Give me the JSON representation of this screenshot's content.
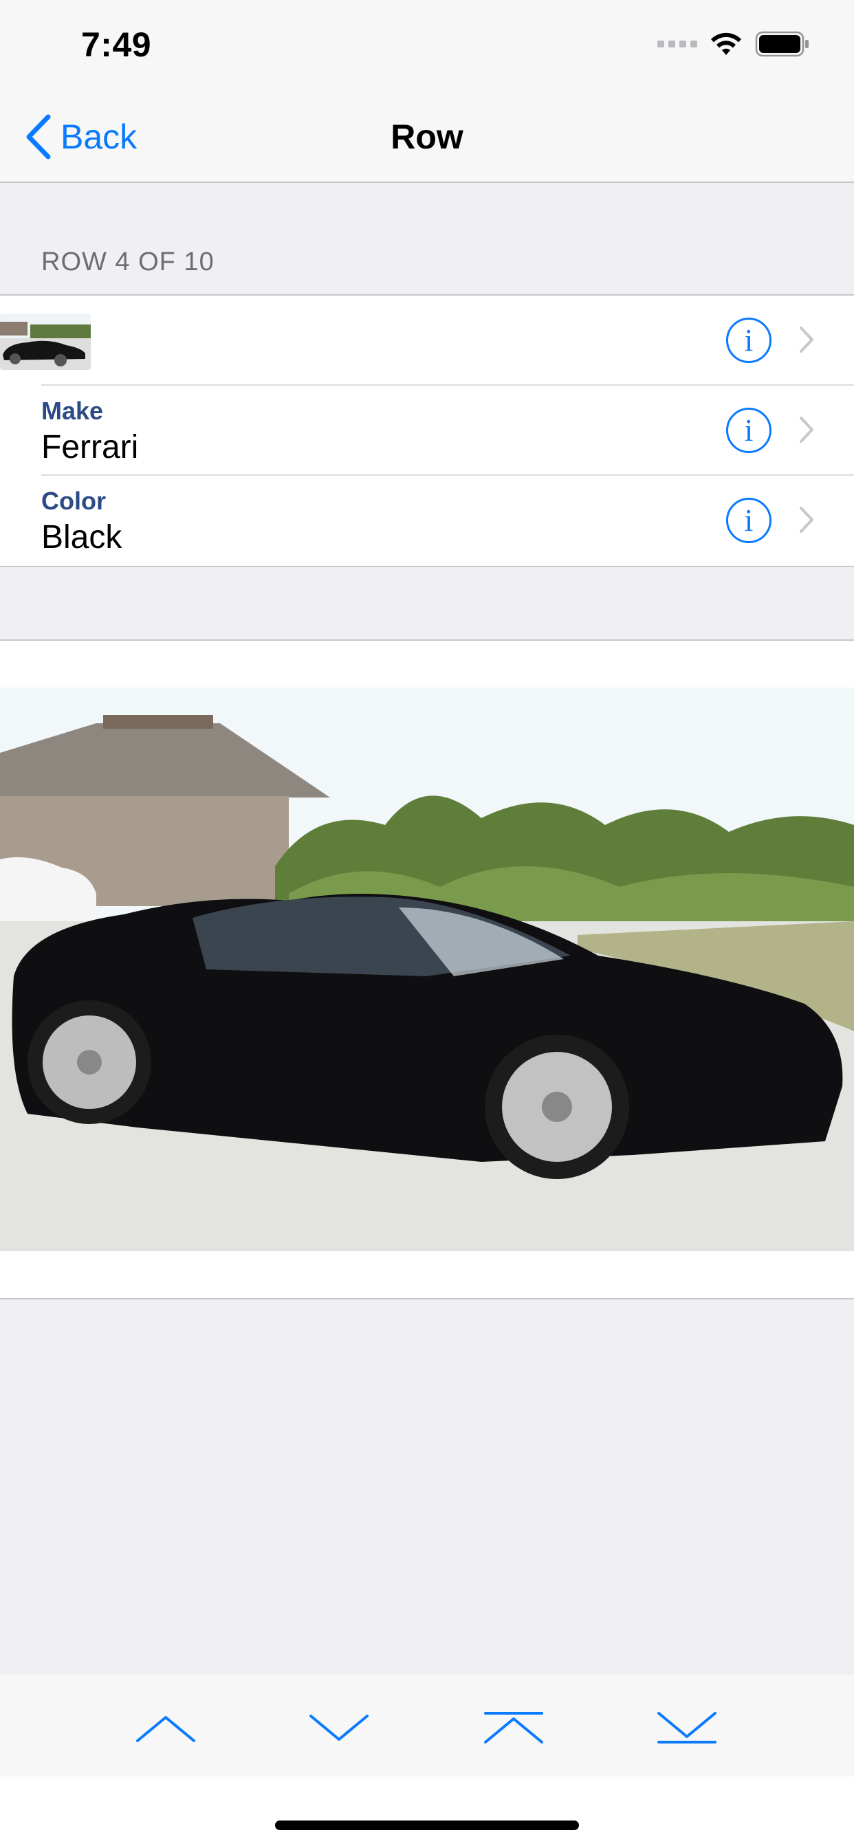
{
  "status_bar": {
    "time": "7:49"
  },
  "nav": {
    "back_label": "Back",
    "title": "Row"
  },
  "section": {
    "header": "ROW 4 OF 10"
  },
  "rows": [
    {
      "type": "thumbnail",
      "icon": "info-icon"
    },
    {
      "label": "Make",
      "value": "Ferrari",
      "icon": "info-icon"
    },
    {
      "label": "Color",
      "value": "Black",
      "icon": "info-icon"
    }
  ],
  "image": {
    "description_icon": "car-photo"
  },
  "toolbar": {
    "buttons": [
      "previous-row",
      "next-row",
      "first-row",
      "last-row"
    ]
  },
  "colors": {
    "accent": "#0a7aff",
    "label": "#2c4a86",
    "background": "#efeff4"
  }
}
